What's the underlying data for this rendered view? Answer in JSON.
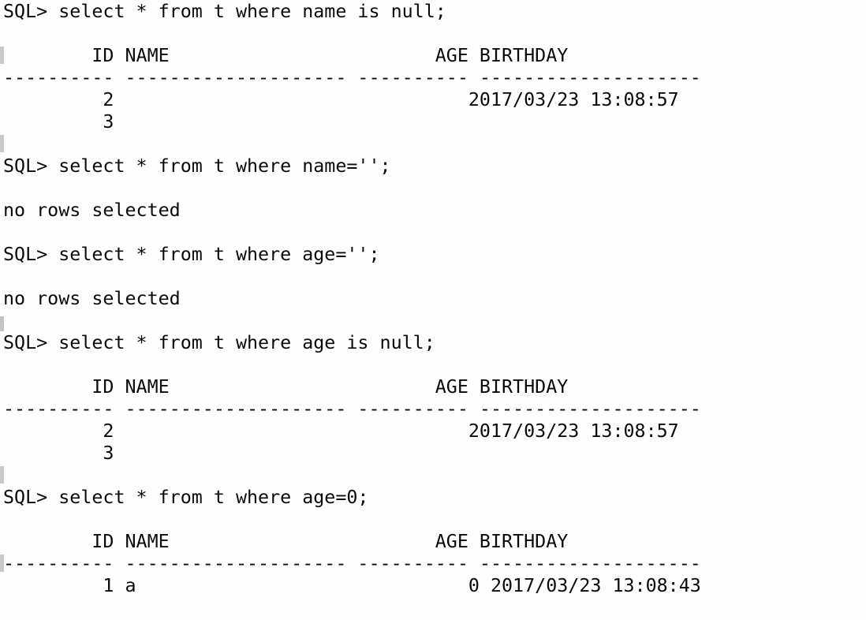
{
  "terminal": {
    "prompt": "SQL>",
    "background_color": "#fefefe",
    "text_color": "#0a0a0a",
    "artifact_color": "#c9c9c9",
    "columns": {
      "id_width": 10,
      "name_width": 20,
      "age_width": 10,
      "birthday_width": 20
    },
    "headers": {
      "id": "ID",
      "name": "NAME",
      "age": "AGE",
      "birthday": "BIRTHDAY"
    },
    "separator_row": "---------- -------------------- ---------- --------------------",
    "header_row": "        ID NAME                        AGE BIRTHDAY",
    "no_rows_message": "no rows selected",
    "lines": [
      {
        "id": "l01",
        "text": "SQL> select * from t where name is null;",
        "artifact": "none"
      },
      {
        "id": "l02",
        "text": "",
        "artifact": "none"
      },
      {
        "id": "l03",
        "text": "        ID NAME                        AGE BIRTHDAY",
        "artifact": "top"
      },
      {
        "id": "l04",
        "text": "---------- -------------------- ---------- --------------------",
        "artifact": "none"
      },
      {
        "id": "l05",
        "text": "         2                                2017/03/23 13:08:57",
        "artifact": "none"
      },
      {
        "id": "l06",
        "text": "         3",
        "artifact": "none"
      },
      {
        "id": "l07",
        "text": "",
        "artifact": "top"
      },
      {
        "id": "l08",
        "text": "SQL> select * from t where name='';",
        "artifact": "none"
      },
      {
        "id": "l09",
        "text": "",
        "artifact": "none"
      },
      {
        "id": "l10",
        "text": "no rows selected",
        "artifact": "none"
      },
      {
        "id": "l11",
        "text": "",
        "artifact": "none"
      },
      {
        "id": "l12",
        "text": "SQL> select * from t where age='';",
        "artifact": "none"
      },
      {
        "id": "l13",
        "text": "",
        "artifact": "none"
      },
      {
        "id": "l14",
        "text": "no rows selected",
        "artifact": "none"
      },
      {
        "id": "l15",
        "text": "",
        "artifact": "low"
      },
      {
        "id": "l16",
        "text": "SQL> select * from t where age is null;",
        "artifact": "none"
      },
      {
        "id": "l17",
        "text": "",
        "artifact": "none"
      },
      {
        "id": "l18",
        "text": "        ID NAME                        AGE BIRTHDAY",
        "artifact": "none"
      },
      {
        "id": "l19",
        "text": "---------- -------------------- ---------- --------------------",
        "artifact": "none"
      },
      {
        "id": "l20",
        "text": "         2                                2017/03/23 13:08:57",
        "artifact": "none"
      },
      {
        "id": "l21",
        "text": "         3",
        "artifact": "none"
      },
      {
        "id": "l22",
        "text": "",
        "artifact": "top"
      },
      {
        "id": "l23",
        "text": "SQL> select * from t where age=0;",
        "artifact": "none"
      },
      {
        "id": "l24",
        "text": "",
        "artifact": "none"
      },
      {
        "id": "l25",
        "text": "        ID NAME                        AGE BIRTHDAY",
        "artifact": "none"
      },
      {
        "id": "l26",
        "text": "---------- -------------------- ---------- --------------------",
        "artifact": "top"
      },
      {
        "id": "l27",
        "text": "         1 a                              0 2017/03/23 13:08:43",
        "artifact": "none"
      },
      {
        "id": "l28",
        "text": "",
        "artifact": "none"
      }
    ],
    "statements": [
      {
        "sql": "select * from t where name is null;",
        "result_type": "table",
        "rows": [
          {
            "id": "2",
            "name": "",
            "age": "",
            "birthday": "2017/03/23 13:08:57"
          },
          {
            "id": "3",
            "name": "",
            "age": "",
            "birthday": ""
          }
        ]
      },
      {
        "sql": "select * from t where name='';",
        "result_type": "no_rows",
        "rows": []
      },
      {
        "sql": "select * from t where age='';",
        "result_type": "no_rows",
        "rows": []
      },
      {
        "sql": "select * from t where age is null;",
        "result_type": "table",
        "rows": [
          {
            "id": "2",
            "name": "",
            "age": "",
            "birthday": "2017/03/23 13:08:57"
          },
          {
            "id": "3",
            "name": "",
            "age": "",
            "birthday": ""
          }
        ]
      },
      {
        "sql": "select * from t where age=0;",
        "result_type": "table",
        "rows": [
          {
            "id": "1",
            "name": "a",
            "age": "0",
            "birthday": "2017/03/23 13:08:43"
          }
        ]
      }
    ]
  }
}
